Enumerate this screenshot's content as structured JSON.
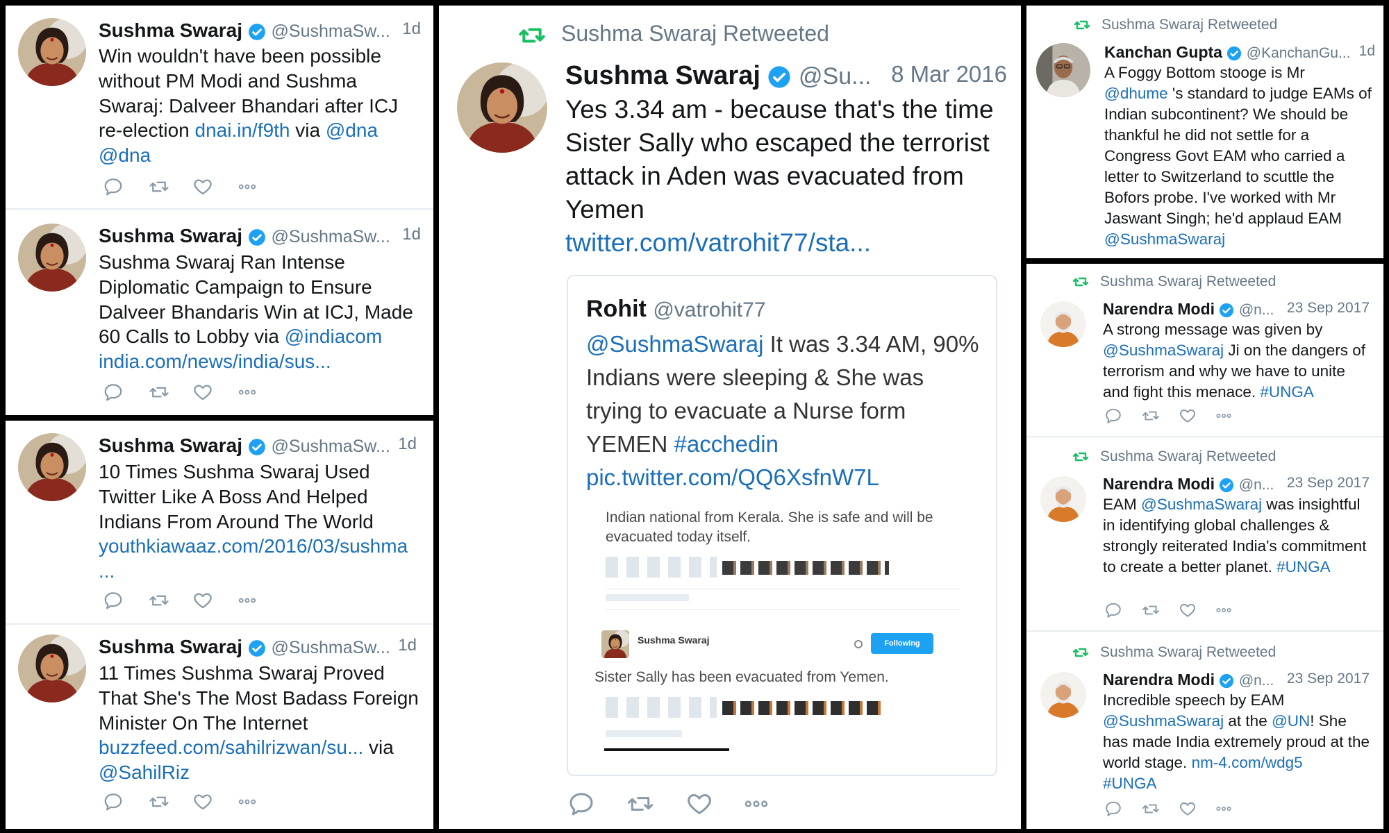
{
  "colors": {
    "link": "#1b6fb8",
    "retweet_green": "#17bf63",
    "verified_blue": "#1da1f2",
    "muted": "#657786"
  },
  "left_top": {
    "tweet1": {
      "name": "Sushma Swaraj",
      "handle": "@SushmaSw...",
      "time": "1d",
      "text": "Win wouldn't have been possible without  PM Modi and Sushma Swaraj: Dalveer Bhandari after ICJ re-election ",
      "link": "dnai.in/f9th",
      "via": " via ",
      "mention1": "@dna",
      "mention2": "@dna"
    },
    "tweet2": {
      "name": "Sushma Swaraj",
      "handle": "@SushmaSw...",
      "time": "1d",
      "text": "Sushma Swaraj Ran Intense Diplomatic Campaign to Ensure Dalveer Bhandaris Win at ICJ, Made 60 Calls to Lobby via ",
      "mention": "@indiacom",
      "link": "india.com/news/india/sus..."
    }
  },
  "left_bottom": {
    "tweet1": {
      "name": "Sushma Swaraj",
      "handle": "@SushmaSw...",
      "time": "1d",
      "text": "10 Times Sushma Swaraj Used Twitter Like A Boss And Helped Indians From Around The World",
      "link": "youthkiawaaz.com/2016/03/sushma",
      "ellipsis": "..."
    },
    "tweet2": {
      "name": "Sushma Swaraj",
      "handle": "@SushmaSw...",
      "time": "1d",
      "text": "11 Times Sushma Swaraj Proved That She's The Most Badass Foreign Minister On The Internet",
      "link": "buzzfeed.com/sahilrizwan/su...",
      "via": " via",
      "mention": "@SahilRiz"
    }
  },
  "center": {
    "retweet_label": "Sushma Swaraj Retweeted",
    "name": "Sushma Swaraj",
    "handle": "@Su...",
    "time": "8 Mar 2016",
    "text": "Yes 3.34 am - because that's the time Sister Sally who escaped the terrorist attack in Aden was evacuated from Yemen",
    "link": "twitter.com/vatrohit77/sta...",
    "quote": {
      "name": "Rohit",
      "handle": "@vatrohit77",
      "mention": "@SushmaSwaraj",
      "text": " It was 3.34 AM, 90% Indians were sleeping & She was trying to evacuate a Nurse form YEMEN ",
      "hashtag": "#acchedin",
      "pic_link": "pic.twitter.com/QQ6XsfnW7L",
      "embed1": "Indian national from Kerala. She is safe and will be evacuated today itself.",
      "embed_name": "Sushma Swaraj",
      "embed_follow": "Following",
      "embed2": "Sister Sally has been evacuated from Yemen."
    }
  },
  "right_top": {
    "retweet_label": "Sushma Swaraj Retweeted",
    "name": "Kanchan Gupta",
    "handle": "@KanchanGu...",
    "time": "1d",
    "text1": "A Foggy Bottom stooge is Mr ",
    "mention1": "@dhume",
    "text2": " 's standard to judge EAMs of Indian subcontinent? We should be thankful he did not settle for a Congress Govt EAM who carried a letter to Switzerland to scuttle the Bofors probe. I've worked with Mr Jaswant Singh; he'd applaud EAM ",
    "mention2": "@SushmaSwaraj"
  },
  "right_bottom": {
    "tweet1": {
      "retweet_label": "Sushma Swaraj Retweeted",
      "name": "Narendra Modi",
      "handle": "@n...",
      "time": "23 Sep 2017",
      "text1": "A strong message was given by ",
      "mention": "@SushmaSwaraj",
      "text2": " Ji on the dangers of terrorism and why we have to unite and fight this menace. ",
      "hashtag": "#UNGA"
    },
    "tweet2": {
      "retweet_label": "Sushma Swaraj Retweeted",
      "name": "Narendra Modi",
      "handle": "@n...",
      "time": "23 Sep 2017",
      "text1": "EAM ",
      "mention": "@SushmaSwaraj",
      "text2": " was insightful in identifying global challenges & strongly reiterated India's commitment to create a better planet. ",
      "hashtag": "#UNGA"
    },
    "tweet3": {
      "retweet_label": "Sushma Swaraj Retweeted",
      "name": "Narendra Modi",
      "handle": "@n...",
      "time": "23 Sep 2017",
      "text1": "Incredible speech by EAM ",
      "mention1": "@SushmaSwaraj",
      "text2": " at the ",
      "mention2": "@UN",
      "text3": "! She has made India extremely proud at the world stage. ",
      "link": "nm-4.com/wdg5",
      "hashtag": "#UNGA"
    }
  },
  "icons": {
    "reply": "reply-icon",
    "retweet": "retweet-icon",
    "like": "heart-icon",
    "more": "more-icon",
    "verified": "verified-badge-icon",
    "retweeted": "retweeted-icon"
  }
}
